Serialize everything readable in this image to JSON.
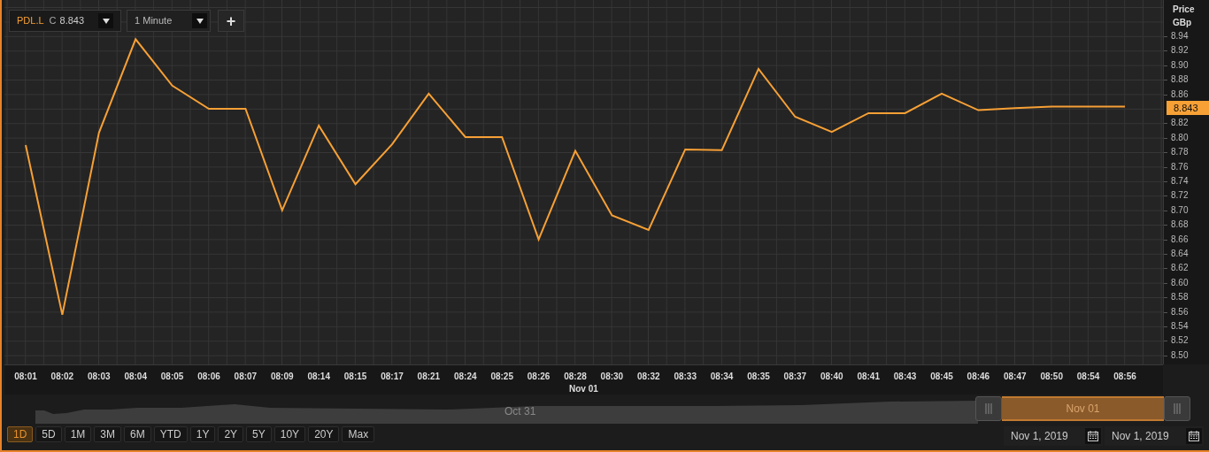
{
  "toolbar": {
    "quote_prefix": "C",
    "quote": "8.843",
    "interval": "1 Minute",
    "add_button": "+"
  },
  "chart": {
    "price_label": "Price",
    "currency": "GBp",
    "last_price": "8.843",
    "date_label": "Nov 01",
    "chart_data": {
      "type": "line",
      "categories": [
        "08:01",
        "08:02",
        "08:03",
        "08:04",
        "08:05",
        "08:06",
        "08:07",
        "08:09",
        "08:14",
        "08:15",
        "08:17",
        "08:21",
        "08:24",
        "08:25",
        "08:26",
        "08:28",
        "08:30",
        "08:32",
        "08:33",
        "08:34",
        "08:35",
        "08:37",
        "08:40",
        "08:41",
        "08:43",
        "08:45",
        "08:46",
        "08:47",
        "08:50",
        "08:54",
        "08:56"
      ],
      "series": [
        {
          "name": "PDL.L",
          "color": "#f7a035",
          "values": [
            8.79,
            8.556,
            8.807,
            8.936,
            8.872,
            8.84,
            8.84,
            8.7,
            8.817,
            8.736,
            8.791,
            8.861,
            8.801,
            8.801,
            8.66,
            8.782,
            8.693,
            8.673,
            8.784,
            8.783,
            8.895,
            8.829,
            8.808,
            8.834,
            8.834,
            8.861,
            8.838,
            8.841,
            8.843,
            8.843,
            8.843
          ]
        }
      ],
      "ylim": [
        8.49,
        8.99
      ],
      "grid": true,
      "yticks": [
        {
          "value": 8.5,
          "label": "8.50"
        },
        8.52,
        8.54,
        8.56,
        8.58,
        {
          "value": 8.6,
          "label": "8.60"
        },
        8.62,
        8.64,
        8.66,
        8.68,
        {
          "value": 8.7,
          "label": "8.70"
        },
        8.72,
        8.74,
        8.76,
        8.78,
        {
          "value": 8.8,
          "label": "8.80"
        },
        8.82,
        8.86,
        8.88,
        {
          "value": 8.9,
          "label": "8.90"
        },
        8.92,
        8.94
      ]
    }
  },
  "navigator": {
    "previous_day": "Oct 31",
    "selected_day": "Nov 01"
  },
  "ranges": [
    {
      "label": "1D",
      "selected": true
    },
    {
      "label": "5D",
      "selected": false
    },
    {
      "label": "1M",
      "selected": false
    },
    {
      "label": "3M",
      "selected": false
    },
    {
      "label": "6M",
      "selected": false
    },
    {
      "label": "YTD",
      "selected": false
    },
    {
      "label": "1Y",
      "selected": false
    },
    {
      "label": "2Y",
      "selected": false
    },
    {
      "label": "5Y",
      "selected": false
    },
    {
      "label": "10Y",
      "selected": false
    },
    {
      "label": "20Y",
      "selected": false
    },
    {
      "label": "Max",
      "selected": false
    }
  ],
  "date_range": {
    "from": "Nov 1, 2019",
    "to": "Nov 1, 2019"
  }
}
